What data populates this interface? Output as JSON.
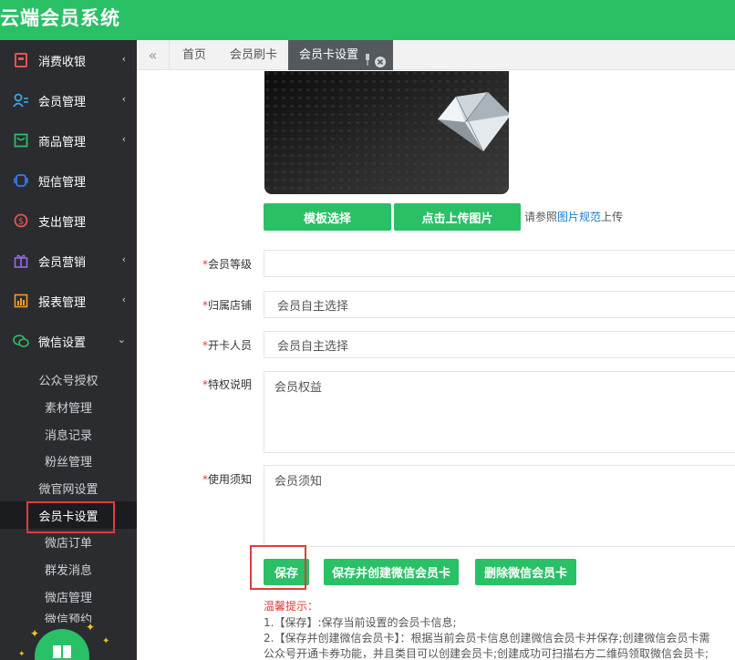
{
  "app": {
    "title": "云端会员系统"
  },
  "sidebar": {
    "items": [
      {
        "label": "消费收银",
        "icon": "cashier-icon",
        "arrow": "‹",
        "color": "#e8544e"
      },
      {
        "label": "会员管理",
        "icon": "members-icon",
        "arrow": "‹",
        "color": "#3aa7e8"
      },
      {
        "label": "商品管理",
        "icon": "goods-icon",
        "arrow": "‹",
        "color": "#2ac066"
      },
      {
        "label": "短信管理",
        "icon": "sms-icon",
        "arrow": "",
        "color": "#3a7be8"
      },
      {
        "label": "支出管理",
        "icon": "expense-icon",
        "arrow": "",
        "color": "#e8544e"
      },
      {
        "label": "会员营销",
        "icon": "gift-icon",
        "arrow": "‹",
        "color": "#9b6ae8"
      },
      {
        "label": "报表管理",
        "icon": "report-icon",
        "arrow": "‹",
        "color": "#f0a020"
      },
      {
        "label": "微信设置",
        "icon": "wechat-icon",
        "arrow": "⌄",
        "color": "#2ac066"
      }
    ],
    "submenu": [
      "公众号授权",
      "素材管理",
      "消息记录",
      "粉丝管理",
      "微官网设置",
      "会员卡设置",
      "微店订单",
      "群发消息",
      "微店管理",
      "微信预约"
    ],
    "active_sub": "会员卡设置"
  },
  "tabs": {
    "prev_icon": "«",
    "items": [
      "首页",
      "会员刷卡",
      "会员卡设置"
    ],
    "active": "会员卡设置",
    "pin_icon": "pin-icon",
    "close_icon": "close-icon"
  },
  "form": {
    "template_button": "模板选择",
    "upload_button": "点击上传图片",
    "hint_prefix": "请参照",
    "hint_link": "图片规范",
    "hint_suffix": "上传",
    "required_mark": "*",
    "level_label": "会员等级",
    "level_value": "",
    "store_label": "归属店铺",
    "store_value": "会员自主选择",
    "opener_label": "开卡人员",
    "opener_value": "会员自主选择",
    "privilege_label": "特权说明",
    "privilege_value": "会员权益",
    "notice_label": "使用须知",
    "notice_value": "会员须知",
    "save_button": "保存",
    "save_create_button": "保存并创建微信会员卡",
    "delete_button": "删除微信会员卡"
  },
  "tips": {
    "title": "温馨提示：",
    "line1": "1.【保存】:保存当前设置的会员卡信息;",
    "line2": "2.【保存并创建微信会员卡】：根据当前会员卡信息创建微信会员卡并保存;创建微信会员卡需",
    "line3": "公众号开通卡券功能，并且类目可以创建会员卡;创建成功可扫描右方二维码领取微信会员卡;"
  },
  "colors": {
    "brand": "#2ac066",
    "sidebar": "#2a2c30",
    "highlight": "#e23b3b",
    "link": "#1a7fd1"
  }
}
